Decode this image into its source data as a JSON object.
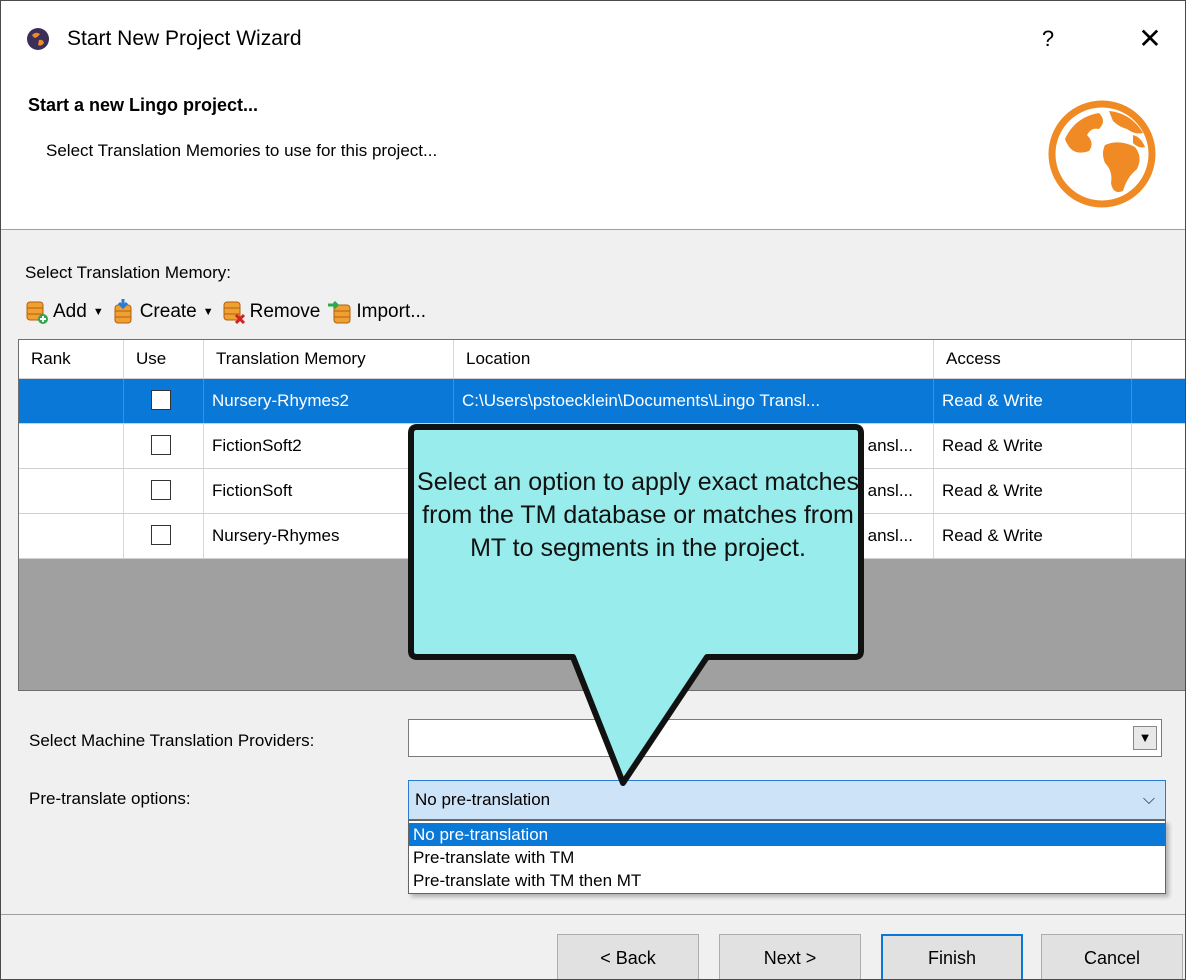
{
  "window": {
    "title": "Start New Project Wizard",
    "help_label": "?",
    "close_label": "✕"
  },
  "header": {
    "title": "Start a new Lingo project...",
    "subtitle": "Select Translation Memories to use for this project..."
  },
  "tm_section": {
    "label": "Select Translation Memory:",
    "toolbar": {
      "add_label": "Add",
      "create_label": "Create",
      "remove_label": "Remove",
      "import_label": "Import..."
    },
    "columns": [
      "Rank",
      "Use",
      "Translation Memory",
      "Location",
      "Access"
    ],
    "rows": [
      {
        "rank": "",
        "use": false,
        "name": "Nursery-Rhymes2",
        "location": "C:\\Users\\pstoecklein\\Documents\\Lingo Transl...",
        "access": "Read & Write",
        "selected": true
      },
      {
        "rank": "",
        "use": false,
        "name": "FictionSoft2",
        "location": "ansl...",
        "access": "Read & Write",
        "selected": false
      },
      {
        "rank": "",
        "use": false,
        "name": "FictionSoft",
        "location": "ansl...",
        "access": "Read & Write",
        "selected": false
      },
      {
        "rank": "",
        "use": false,
        "name": "Nursery-Rhymes",
        "location": "ansl...",
        "access": "Read & Write",
        "selected": false
      }
    ]
  },
  "mt_providers": {
    "label": "Select Machine Translation Providers:",
    "value": ""
  },
  "pretranslate": {
    "label": "Pre-translate options:",
    "value": "No pre-translation",
    "options": [
      "No pre-translation",
      "Pre-translate with TM",
      "Pre-translate with TM then MT"
    ]
  },
  "callout": {
    "text": "Select an option to apply exact matches from the TM database or matches from MT to segments in the project."
  },
  "buttons": {
    "back": "< Back",
    "next": "Next >",
    "finish": "Finish",
    "cancel": "Cancel"
  },
  "colors": {
    "selection": "#0a78d7",
    "callout_fill": "#99ecec",
    "globe_orange": "#f08a24"
  }
}
